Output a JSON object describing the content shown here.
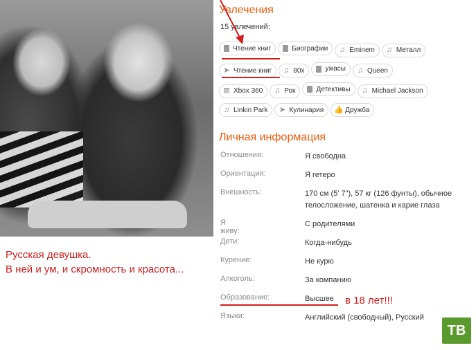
{
  "hobbies": {
    "title": "Увлечения",
    "count": "15 увлечений:",
    "tags": [
      {
        "label": "Чтение книг",
        "icon": "book-icon"
      },
      {
        "label": "Биографии",
        "icon": "book-icon"
      },
      {
        "label": "Eminem",
        "icon": "music-icon"
      },
      {
        "label": "Металл",
        "icon": "music-icon"
      },
      {
        "label": "Чтение книг",
        "icon": "plane-icon"
      },
      {
        "label": "80х",
        "icon": "music-icon"
      },
      {
        "label": "ужасы",
        "icon": "book-icon"
      },
      {
        "label": "Queen",
        "icon": "music-icon"
      },
      {
        "label": "Xbox 360",
        "icon": "gamepad-icon"
      },
      {
        "label": "Рок",
        "icon": "music-icon"
      },
      {
        "label": "Детективы",
        "icon": "book-icon"
      },
      {
        "label": "Michael Jackson",
        "icon": "music-icon"
      },
      {
        "label": "Linkin Park",
        "icon": "music-icon"
      },
      {
        "label": "Кулинария",
        "icon": "plane-icon"
      },
      {
        "label": "Дружба",
        "icon": "thumbs-up-icon"
      }
    ]
  },
  "personal": {
    "title": "Личная информация",
    "rows": [
      {
        "label": "Отношения:",
        "value": "Я свободна"
      },
      {
        "label": "Ориентация:",
        "value": "Я гетеро"
      },
      {
        "label": "Внешность:",
        "value": "170 см (5' 7\"), 57 кг (126 фунты), обычное телосложение, шатенка и карие глаза"
      },
      {
        "label": "Я живу:",
        "value": "С родителями"
      },
      {
        "label": "Дети:",
        "value": "Когда-нибудь"
      },
      {
        "label": "Курение:",
        "value": "Не курю"
      },
      {
        "label": "Алкоголь:",
        "value": "За компанию"
      },
      {
        "label": "Образование:",
        "value": "Высшее"
      },
      {
        "label": "Языки:",
        "value": "Английский (свободный), Русский"
      }
    ]
  },
  "annotations": {
    "caption_line1": "Русская девушка.",
    "caption_line2": "В ней и ум, и скромность и красота...",
    "education_note": "в 18 лет!!!",
    "color": "#d11d1d"
  },
  "watermark": "ТВ",
  "colors": {
    "accent": "#f05a0a",
    "watermark_bg": "#5b9a2c"
  }
}
